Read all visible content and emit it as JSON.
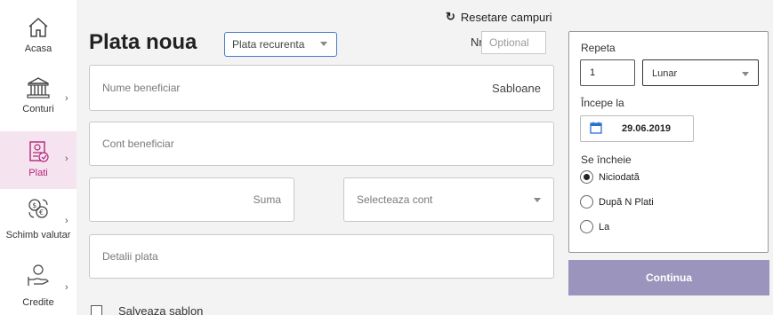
{
  "sidebar": {
    "items": [
      {
        "label": "Acasa",
        "icon": "home-icon"
      },
      {
        "label": "Conturi",
        "icon": "bank-icon"
      },
      {
        "label": "Plati",
        "icon": "payment-icon",
        "active": true
      },
      {
        "label": "Schimb valutar",
        "icon": "currency-exchange-icon"
      },
      {
        "label": "Credite",
        "icon": "credit-hand-icon"
      }
    ]
  },
  "header": {
    "reset_label": "Resetare campuri",
    "title": "Plata noua",
    "payment_type": "Plata recurenta",
    "nr_label": "Nr",
    "nr_placeholder": "Optional"
  },
  "form": {
    "beneficiary_name_placeholder": "Nume beneficiar",
    "templates_link": "Sabloane",
    "beneficiary_account_placeholder": "Cont beneficiar",
    "amount_placeholder": "Suma",
    "select_account_placeholder": "Selecteaza cont",
    "details_placeholder": "Detalii plata",
    "save_template_label": "Salveaza sablon"
  },
  "repeat": {
    "title": "Repeta",
    "count": "1",
    "unit": "Lunar",
    "start_label": "Începe la",
    "start_date": "29.06.2019",
    "end_label": "Se încheie",
    "options": [
      {
        "label": "Niciodată",
        "selected": true
      },
      {
        "label": "După N Plati",
        "selected": false
      },
      {
        "label": "La",
        "selected": false
      }
    ]
  },
  "continue_label": "Continua",
  "colors": {
    "accent": "#b0287a",
    "active_nav_bg": "#f6e3f0",
    "continue_button": "#9b95bd",
    "panel_bg": "#f4f3f4"
  }
}
